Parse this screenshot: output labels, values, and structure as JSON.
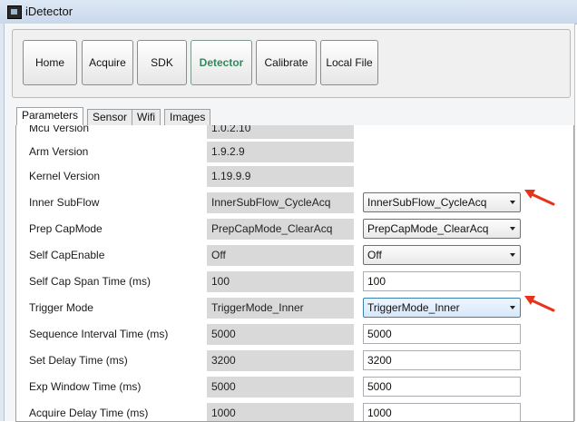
{
  "window": {
    "title": "iDetector"
  },
  "toolbar": {
    "buttons": [
      {
        "label": "Home"
      },
      {
        "label": "Acquire"
      },
      {
        "label": "SDK"
      },
      {
        "label": "Detector"
      },
      {
        "label": "Calibrate"
      },
      {
        "label": "Local File"
      }
    ],
    "active": "Detector"
  },
  "tabs": [
    {
      "label": "Parameters"
    },
    {
      "label": "Sensor"
    },
    {
      "label": "Wifi"
    },
    {
      "label": "Images"
    }
  ],
  "active_tab": "Parameters",
  "params": [
    {
      "label": "Mcu Version",
      "value": "1.0.2.10"
    },
    {
      "label": "Arm Version",
      "value": "1.9.2.9"
    },
    {
      "label": "Kernel Version",
      "value": "1.19.9.9"
    },
    {
      "label": "Inner SubFlow",
      "value": "InnerSubFlow_CycleAcq",
      "control": "InnerSubFlow_CycleAcq"
    },
    {
      "label": "Prep CapMode",
      "value": "PrepCapMode_ClearAcq",
      "control": "PrepCapMode_ClearAcq"
    },
    {
      "label": "Self CapEnable",
      "value": "Off",
      "control": "Off"
    },
    {
      "label": "Self Cap Span Time (ms)",
      "value": "100",
      "control": "100"
    },
    {
      "label": "Trigger Mode",
      "value": "TriggerMode_Inner",
      "control": "TriggerMode_Inner"
    },
    {
      "label": "Sequence Interval Time (ms)",
      "value": "5000",
      "control": "5000"
    },
    {
      "label": "Set Delay Time (ms)",
      "value": "3200",
      "control": "3200"
    },
    {
      "label": "Exp Window Time (ms)",
      "value": "5000",
      "control": "5000"
    },
    {
      "label": "Acquire Delay Time (ms)",
      "value": "1000",
      "control": "1000"
    }
  ],
  "annotation": {
    "arrow_color": "#e8331b"
  }
}
